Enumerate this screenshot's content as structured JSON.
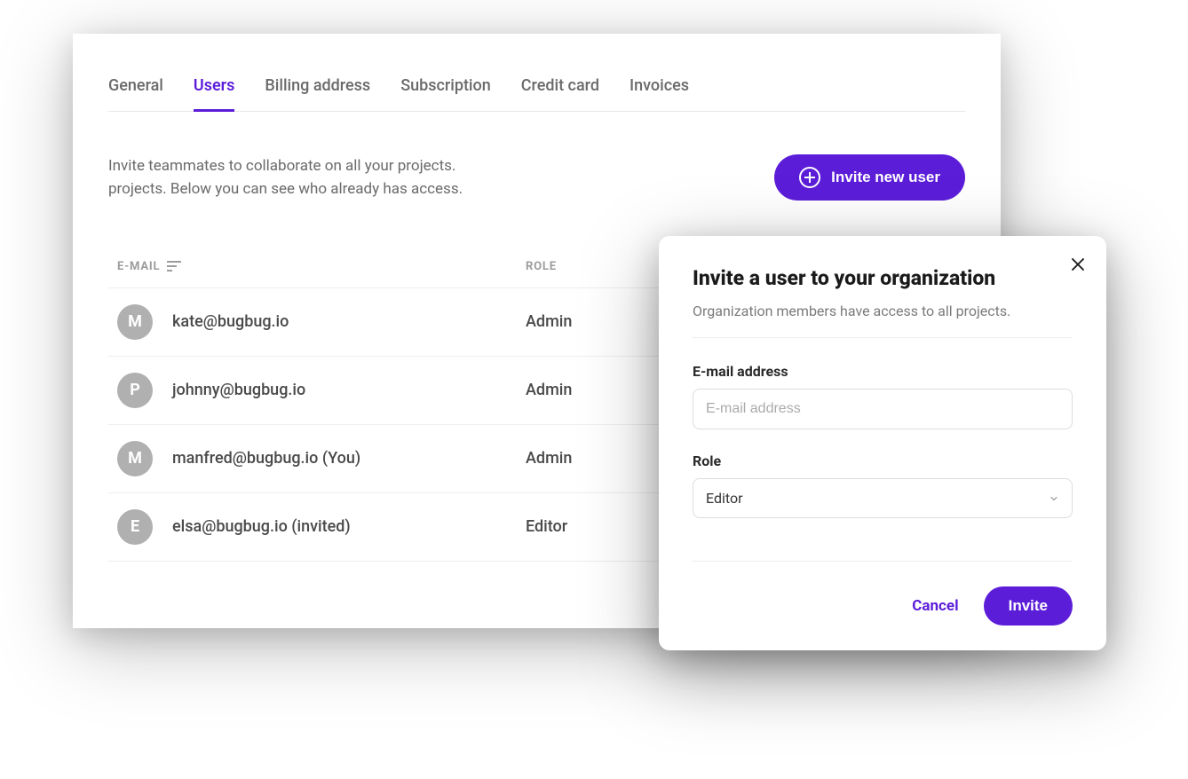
{
  "tabs": [
    {
      "label": "General",
      "active": false
    },
    {
      "label": "Users",
      "active": true
    },
    {
      "label": "Billing address",
      "active": false
    },
    {
      "label": "Subscription",
      "active": false
    },
    {
      "label": "Credit card",
      "active": false
    },
    {
      "label": "Invoices",
      "active": false
    }
  ],
  "intro": {
    "line1": "Invite teammates to collaborate on all your projects.",
    "line2": "projects. Below you can see who already has access."
  },
  "invite_button_label": "Invite new user",
  "table": {
    "headers": {
      "email": "E-MAIL",
      "role": "ROLE"
    },
    "rows": [
      {
        "initial": "M",
        "email": "kate@bugbug.io",
        "role": "Admin"
      },
      {
        "initial": "P",
        "email": "johnny@bugbug.io",
        "role": "Admin"
      },
      {
        "initial": "M",
        "email": "manfred@bugbug.io (You)",
        "role": "Admin"
      },
      {
        "initial": "E",
        "email": "elsa@bugbug.io (invited)",
        "role": "Editor"
      }
    ]
  },
  "modal": {
    "title": "Invite a user to your organization",
    "subtitle": "Organization members have access to all projects.",
    "email_label": "E-mail address",
    "email_placeholder": "E-mail address",
    "role_label": "Role",
    "role_value": "Editor",
    "cancel": "Cancel",
    "submit": "Invite"
  }
}
